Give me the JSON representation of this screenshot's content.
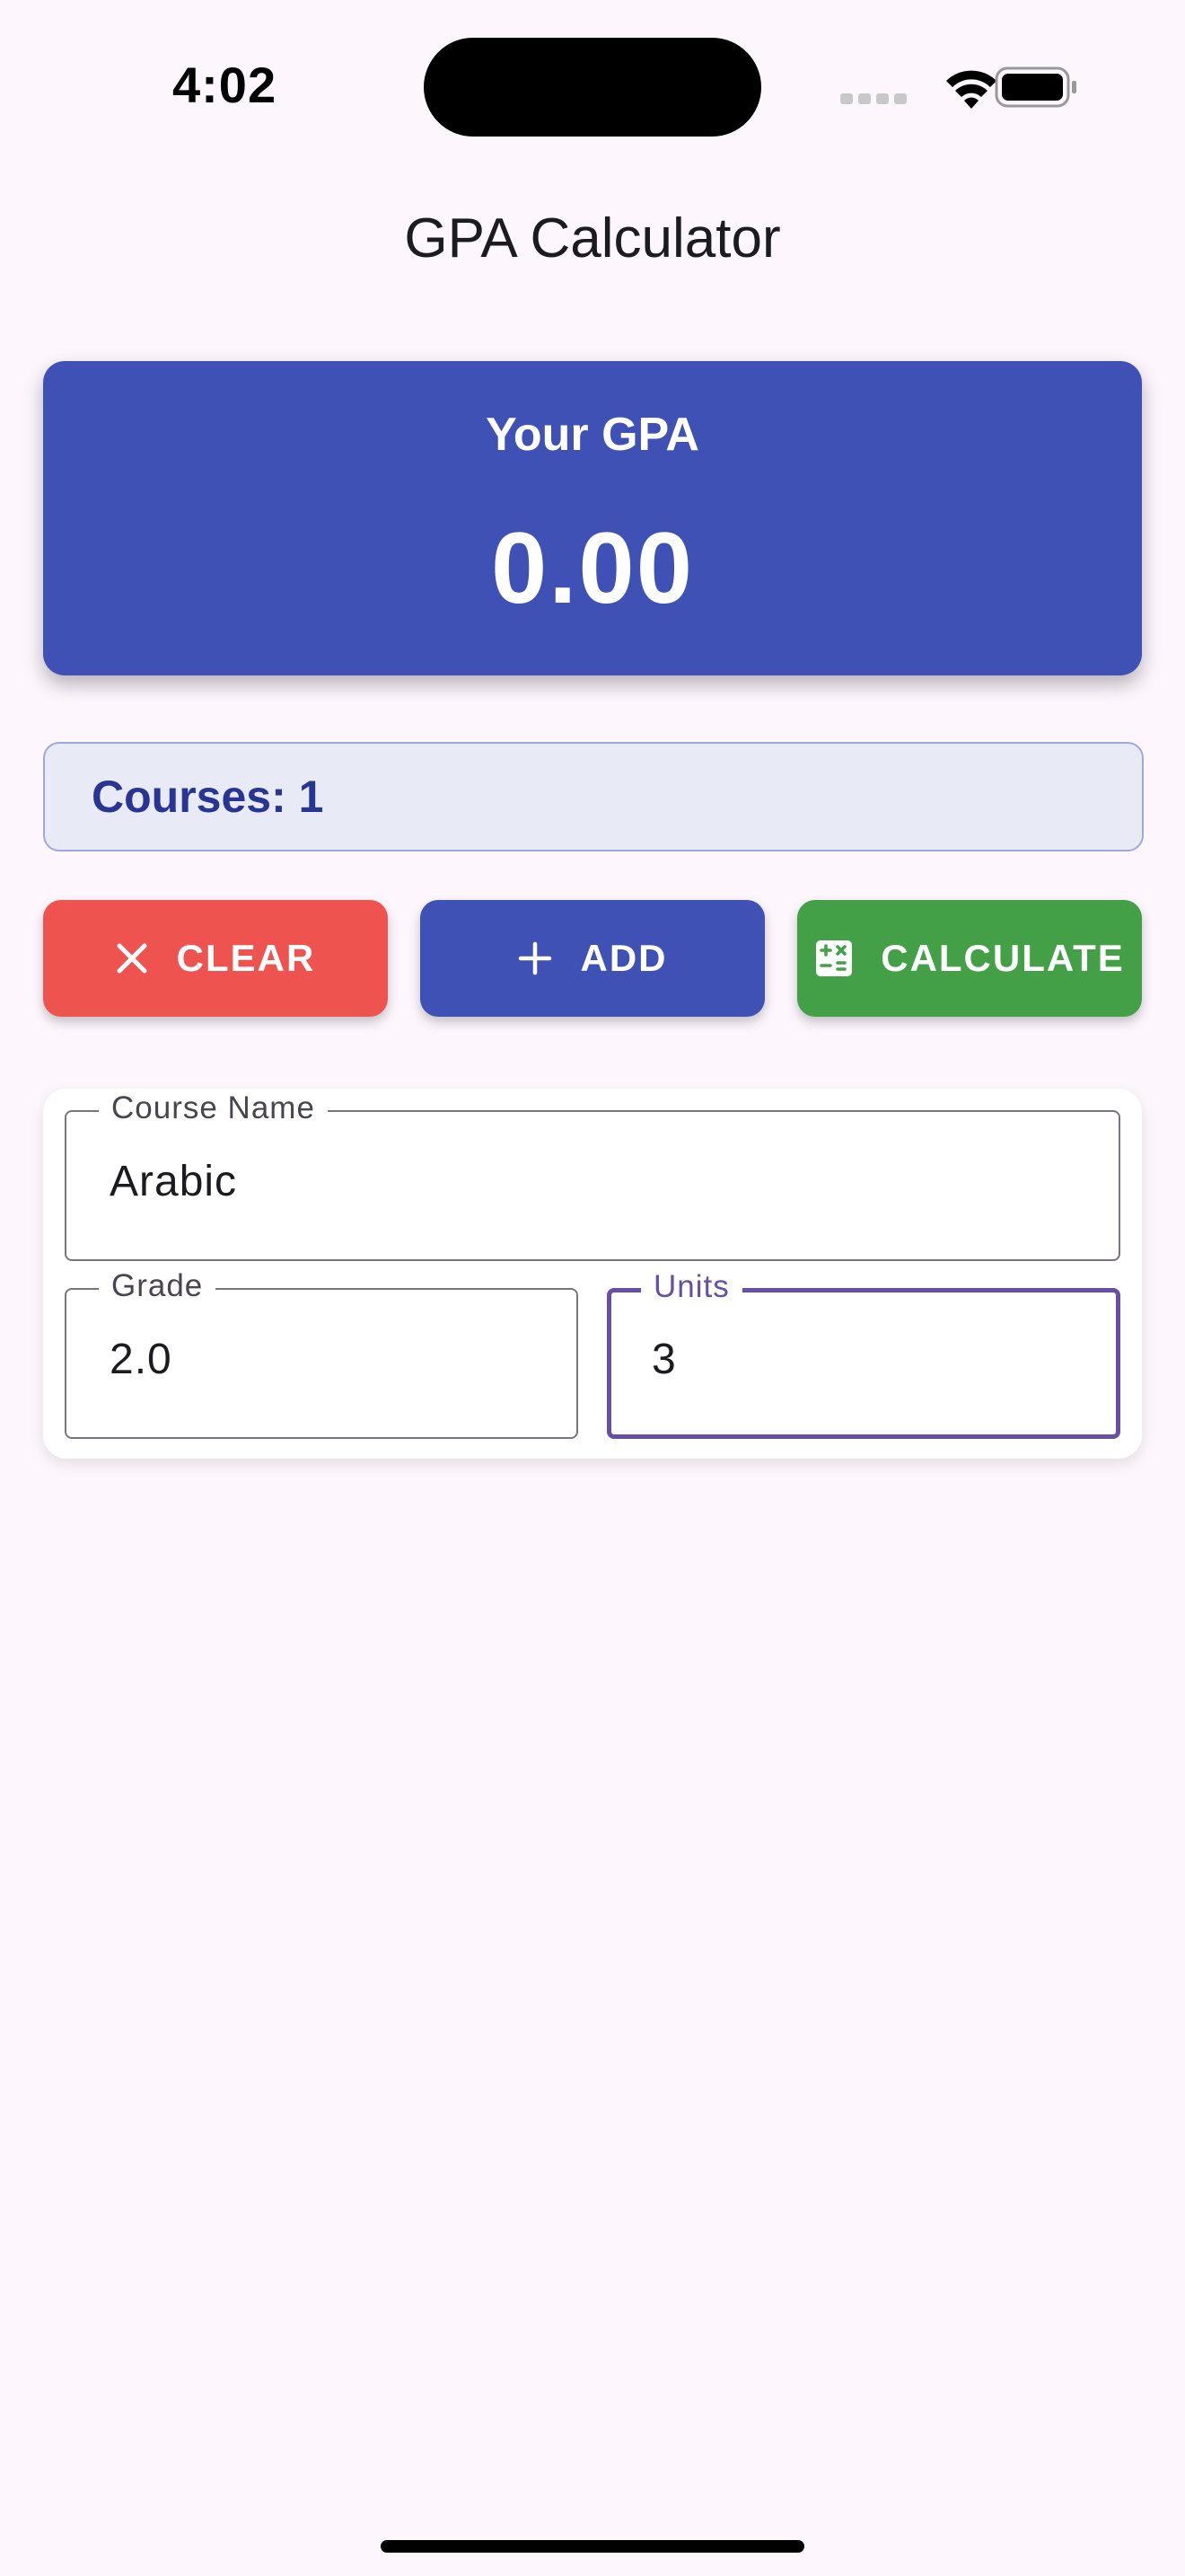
{
  "status_bar": {
    "time": "4:02"
  },
  "header": {
    "title": "GPA Calculator"
  },
  "gpa_card": {
    "label": "Your GPA",
    "value": "0.00"
  },
  "courses_summary": {
    "text": "Courses: 1"
  },
  "actions": {
    "clear_label": "CLEAR",
    "add_label": "ADD",
    "calculate_label": "CALCULATE"
  },
  "course_form": {
    "course_name": {
      "label": "Course Name",
      "value": "Arabic"
    },
    "grade": {
      "label": "Grade",
      "value": "2.0"
    },
    "units": {
      "label": "Units",
      "value": "3"
    }
  },
  "icons": {
    "clear": "close-icon",
    "add": "plus-icon",
    "calculate": "calculator-icon",
    "signal": "cellular-signal-icon",
    "wifi": "wifi-icon",
    "battery": "battery-icon"
  },
  "colors": {
    "background": "#fdf6fd",
    "primary": "#3f51b5",
    "clear_button": "#ef5350",
    "calculate_button": "#43a047",
    "courses_box_bg": "#e8eaf6",
    "courses_text": "#283593",
    "focus_outline": "#6750a4"
  }
}
